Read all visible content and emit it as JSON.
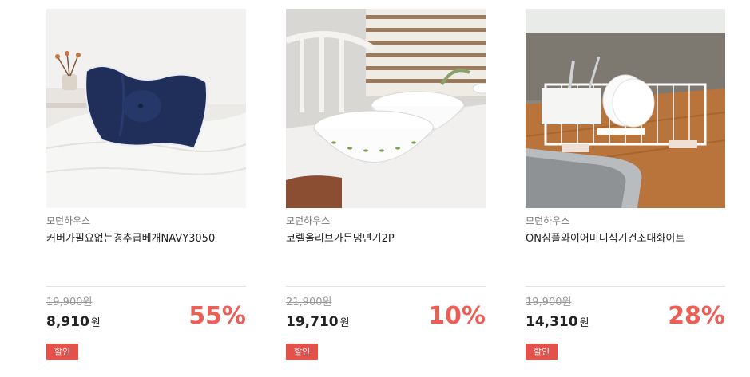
{
  "products": [
    {
      "brand": "모던하우스",
      "name": "커버가필요없는경추굽베개NAVY3050",
      "original_price": "19,900원",
      "sale_price": "8,910",
      "currency": "원",
      "discount": "55%",
      "badge": "할인",
      "image_icon": "navy-pillow-photo"
    },
    {
      "brand": "모던하우스",
      "name": "코렐올리브가든냉면기2P",
      "original_price": "21,900원",
      "sale_price": "19,710",
      "currency": "원",
      "discount": "10%",
      "badge": "할인",
      "image_icon": "white-bowls-photo"
    },
    {
      "brand": "모던하우스",
      "name": "ON심플와이어미니식기건조대화이트",
      "original_price": "19,900원",
      "sale_price": "14,310",
      "currency": "원",
      "discount": "28%",
      "badge": "할인",
      "image_icon": "dish-rack-photo"
    }
  ],
  "colors": {
    "discount": "#ec5f57",
    "badge_bg": "#e4504a",
    "divider": "#e3e3e3"
  }
}
